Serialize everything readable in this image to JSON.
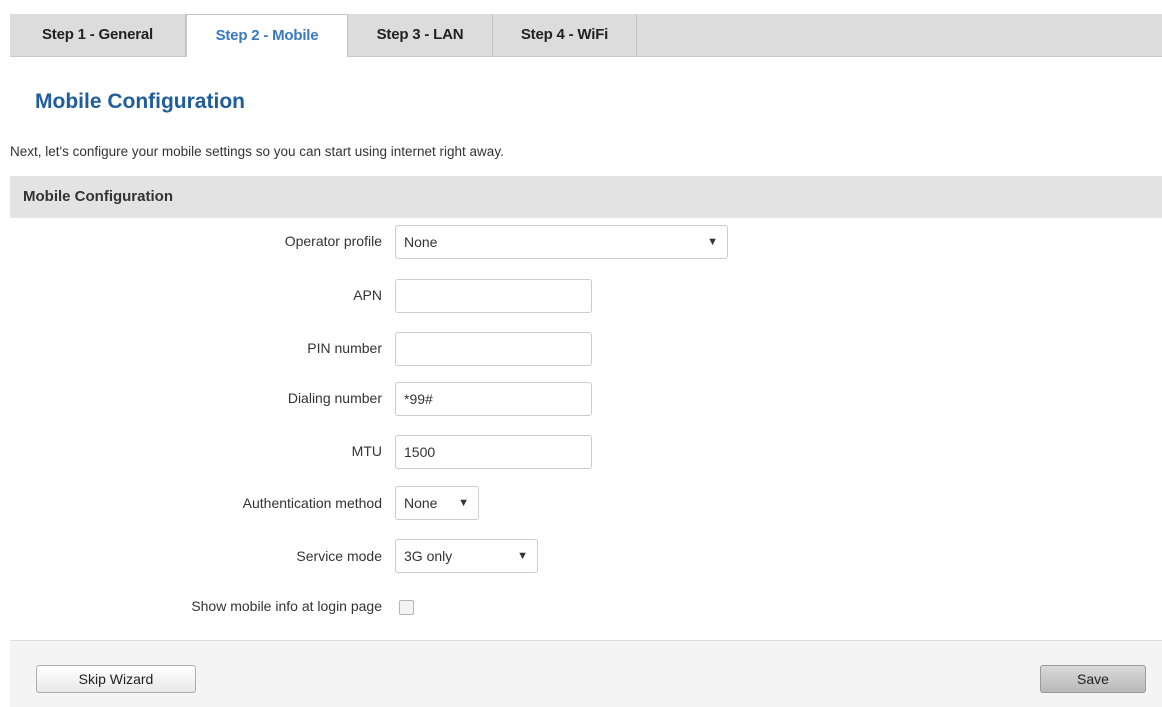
{
  "tabs": [
    {
      "label": "Step 1 - General",
      "active": false
    },
    {
      "label": "Step 2 - Mobile",
      "active": true
    },
    {
      "label": "Step 3 - LAN",
      "active": false
    },
    {
      "label": "Step 4 - WiFi",
      "active": false
    }
  ],
  "page": {
    "title": "Mobile Configuration",
    "intro": "Next, let's configure your mobile settings so you can start using internet right away."
  },
  "section": {
    "title": "Mobile Configuration"
  },
  "form": {
    "operator_profile": {
      "label": "Operator profile",
      "value": "None"
    },
    "apn": {
      "label": "APN",
      "value": ""
    },
    "pin": {
      "label": "PIN number",
      "value": ""
    },
    "dialing": {
      "label": "Dialing number",
      "value": "*99#"
    },
    "mtu": {
      "label": "MTU",
      "value": "1500"
    },
    "auth": {
      "label": "Authentication method",
      "value": "None"
    },
    "service": {
      "label": "Service mode",
      "value": "3G only"
    },
    "show_info": {
      "label": "Show mobile info at login page",
      "checked": false
    }
  },
  "icons": {
    "dropdown": "▼"
  },
  "buttons": {
    "skip": "Skip Wizard",
    "save": "Save"
  },
  "colors": {
    "accent": "#1f5d9c",
    "active_tab_text": "#3a78bf",
    "tab_bar": "#dcdcdc",
    "section_header": "#e3e3e3"
  }
}
